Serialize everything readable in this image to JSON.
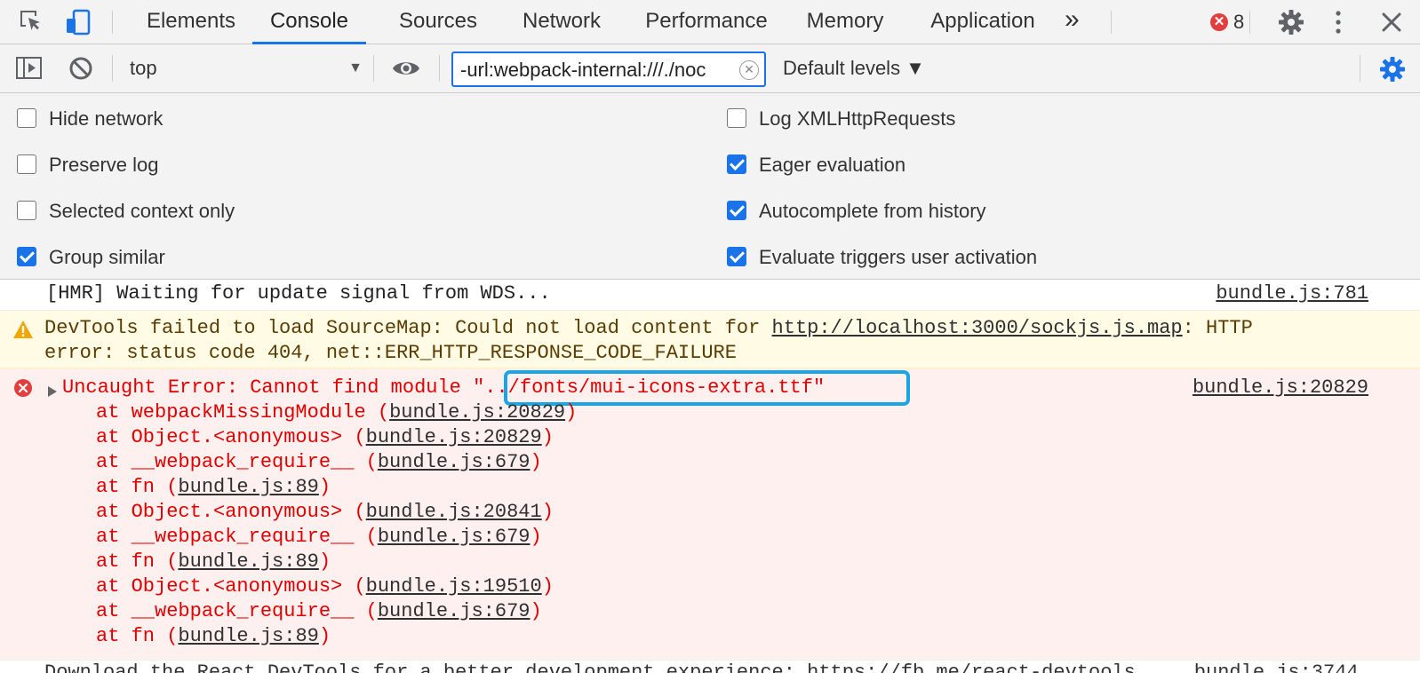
{
  "tabbar": {
    "tabs": [
      {
        "id": "elements",
        "label": "Elements",
        "active": false
      },
      {
        "id": "console",
        "label": "Console",
        "active": true
      },
      {
        "id": "sources",
        "label": "Sources",
        "active": false
      },
      {
        "id": "network",
        "label": "Network",
        "active": false
      },
      {
        "id": "performance",
        "label": "Performance",
        "active": false
      },
      {
        "id": "memory",
        "label": "Memory",
        "active": false
      },
      {
        "id": "application",
        "label": "Application",
        "active": false
      }
    ],
    "more_tabs": "»",
    "error_count": "8",
    "close_glyph": "✕",
    "accent_color": "#1a73e8"
  },
  "toolbar": {
    "context": "top",
    "filter_value": "-url:webpack-internal:///./noc",
    "levels": "Default levels ▼"
  },
  "settings": {
    "left": [
      {
        "id": "hide-network",
        "label": "Hide network",
        "checked": false
      },
      {
        "id": "preserve-log",
        "label": "Preserve log",
        "checked": false
      },
      {
        "id": "selected-context-only",
        "label": "Selected context only",
        "checked": false
      },
      {
        "id": "group-similar",
        "label": "Group similar",
        "checked": true
      }
    ],
    "right": [
      {
        "id": "log-xmlhttprequests",
        "label": "Log XMLHttpRequests",
        "checked": false
      },
      {
        "id": "eager-evaluation",
        "label": "Eager evaluation",
        "checked": true
      },
      {
        "id": "autocomplete-from-history",
        "label": "Autocomplete from history",
        "checked": true
      },
      {
        "id": "evaluate-triggers-user-activation",
        "label": "Evaluate triggers user activation",
        "checked": true
      }
    ]
  },
  "console": {
    "info": {
      "text": "[HMR] Waiting for update signal from WDS...",
      "source": "bundle.js:781"
    },
    "warning": {
      "prefix": "DevTools failed to load SourceMap: Could not load content for ",
      "url": "http://localhost:3000/sockjs.js.map",
      "suffix": ": HTTP",
      "line2": "error: status code 404, net::ERR_HTTP_RESPONSE_CODE_FAILURE"
    },
    "error": {
      "message": "Uncaught Error: Cannot find module ",
      "module": "\"../fonts/mui-icons-extra.ttf\"",
      "source": "bundle.js:20829",
      "stack": [
        {
          "fn": "at webpackMissingModule (",
          "loc": "bundle.js:20829",
          "end": ")"
        },
        {
          "fn": "at Object.<anonymous> (",
          "loc": "bundle.js:20829",
          "end": ")"
        },
        {
          "fn": "at __webpack_require__ (",
          "loc": "bundle.js:679",
          "end": ")"
        },
        {
          "fn": "at fn (",
          "loc": "bundle.js:89",
          "end": ")"
        },
        {
          "fn": "at Object.<anonymous> (",
          "loc": "bundle.js:20841",
          "end": ")"
        },
        {
          "fn": "at __webpack_require__ (",
          "loc": "bundle.js:679",
          "end": ")"
        },
        {
          "fn": "at fn (",
          "loc": "bundle.js:89",
          "end": ")"
        },
        {
          "fn": "at Object.<anonymous> (",
          "loc": "bundle.js:19510",
          "end": ")"
        },
        {
          "fn": "at __webpack_require__ (",
          "loc": "bundle.js:679",
          "end": ")"
        },
        {
          "fn": "at fn (",
          "loc": "bundle.js:89",
          "end": ")"
        }
      ]
    },
    "next_partial": "Download the React DevTools for a better development experience: https://fb.me/react-devtools     bundle.js:3744"
  }
}
